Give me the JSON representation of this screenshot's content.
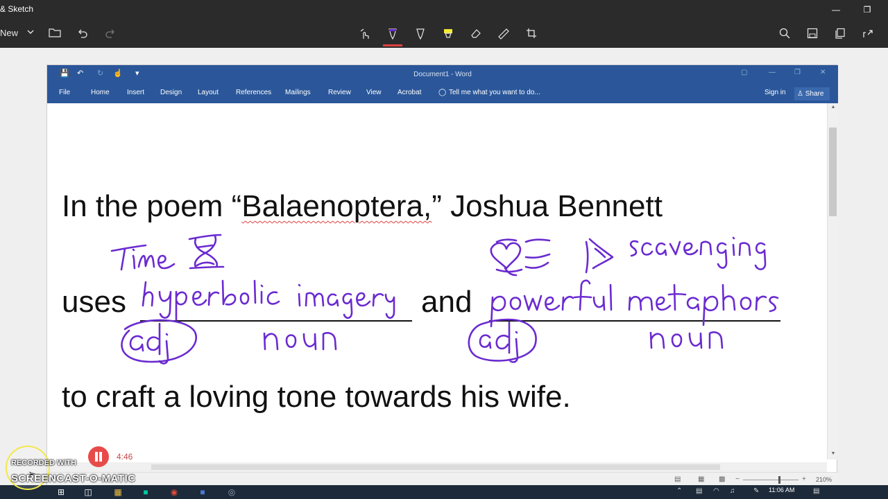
{
  "sketch": {
    "app_title": "& Sketch",
    "new_label": "New",
    "tools": [
      "touch-writing",
      "ballpoint-pen",
      "pencil",
      "highlighter",
      "eraser",
      "ruler",
      "crop"
    ],
    "active_color": "#6a2ad0"
  },
  "word": {
    "window_title": "Document1 - Word",
    "tabs": [
      "File",
      "Home",
      "Insert",
      "Design",
      "Layout",
      "References",
      "Mailings",
      "Review",
      "View",
      "Acrobat"
    ],
    "tell_me": "Tell me what you want to do...",
    "sign_in": "Sign in",
    "share": "Share",
    "zoom": "210%",
    "brand_color": "#2b579a"
  },
  "document": {
    "line1_pre": "In the poem “",
    "line1_word": "Balaenoptera,",
    "line1_post": "” Joshua Bennett",
    "line2_uses": "uses",
    "line2_and": "and",
    "line3": "to craft a loving tone towards his wife."
  },
  "ink": {
    "color": "#6a2ad0",
    "notes": [
      "Time",
      "hyperbolic",
      "imagery",
      "adj",
      "noun",
      "scavenging",
      "powerful",
      "metaphors",
      "adj",
      "noun"
    ]
  },
  "recorder": {
    "recorded_with": "RECORDED WITH",
    "brand": "SCREENCAST-O-MATIC",
    "time": "4:46"
  },
  "taskbar": {
    "clock": "11:06 AM"
  }
}
